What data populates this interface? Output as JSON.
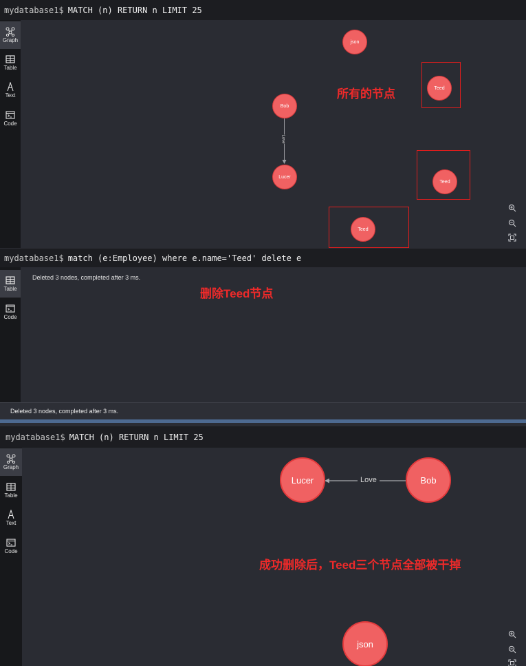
{
  "panel1": {
    "prompt": "mydatabase1$",
    "query": "MATCH (n) RETURN n LIMIT 25",
    "sidebar": [
      "Graph",
      "Table",
      "Text",
      "Code"
    ],
    "nodes": {
      "json": "json",
      "bob": "Bob",
      "lucer": "Lucer",
      "teed1": "Teed",
      "teed2": "Teed",
      "teed3": "Teed"
    },
    "relationship": "Love",
    "annotation": "所有的节点"
  },
  "panel2": {
    "prompt": "mydatabase1$",
    "query": "match (e:Employee) where e.name='Teed' delete e",
    "sidebar": [
      "Table",
      "Code"
    ],
    "message": "Deleted 3 nodes, completed after 3 ms.",
    "annotation": "删除Teed节点",
    "status": "Deleted 3 nodes, completed after 3 ms."
  },
  "panel3": {
    "prompt": "mydatabase1$",
    "query": "MATCH (n) RETURN n LIMIT 25",
    "sidebar": [
      "Graph",
      "Table",
      "Text",
      "Code"
    ],
    "nodes": {
      "lucer": "Lucer",
      "bob": "Bob",
      "json": "json"
    },
    "relationship": "Love",
    "annotation": "成功删除后，Teed三个节点全部被干掉"
  },
  "colors": {
    "node_fill": "#f06162",
    "annotation_red": "#ee2a2a",
    "background": "#2a2c33"
  }
}
